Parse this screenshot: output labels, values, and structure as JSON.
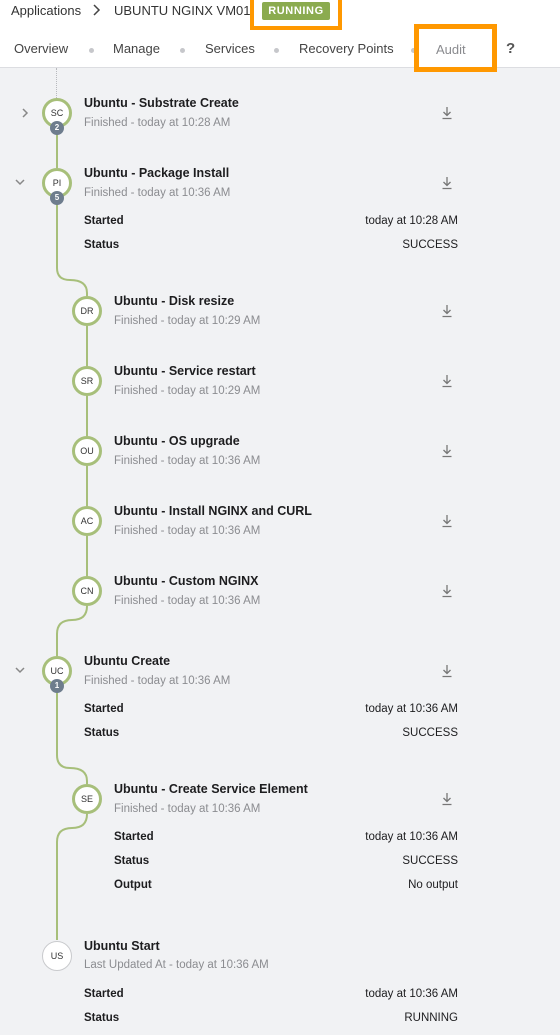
{
  "breadcrumb": {
    "root": "Applications",
    "app_name": "UBUNTU NGINX VM01",
    "status": "RUNNING"
  },
  "tabs": [
    "Overview",
    "Manage",
    "Services",
    "Recovery Points",
    "Audit"
  ],
  "help_label": "?",
  "colors": {
    "running": "#8bab4f",
    "node_ring": "#a7bf7a",
    "highlight": "#ff9800"
  },
  "audit": {
    "items": [
      {
        "abbr": "SC",
        "count": "2",
        "title": "Ubuntu - Substrate Create",
        "sub": "Finished - today at 10:28 AM",
        "icon": "chevron-right-icon"
      },
      {
        "abbr": "PI",
        "count": "5",
        "title": "Ubuntu - Package Install",
        "sub": "Finished - today at 10:36 AM",
        "icon": "chevron-down-icon",
        "details": [
          {
            "key": "Started",
            "value": "today at 10:28 AM"
          },
          {
            "key": "Status",
            "value": "SUCCESS"
          }
        ]
      },
      {
        "abbr": "DR",
        "title": "Ubuntu - Disk resize",
        "sub": "Finished - today at 10:29 AM"
      },
      {
        "abbr": "SR",
        "title": "Ubuntu - Service restart",
        "sub": "Finished - today at 10:29 AM"
      },
      {
        "abbr": "OU",
        "title": "Ubuntu - OS upgrade",
        "sub": "Finished - today at 10:36 AM"
      },
      {
        "abbr": "AC",
        "title": "Ubuntu - Install NGINX and CURL",
        "sub": "Finished - today at 10:36 AM"
      },
      {
        "abbr": "CN",
        "title": "Ubuntu - Custom NGINX",
        "sub": "Finished - today at 10:36 AM"
      },
      {
        "abbr": "UC",
        "count": "1",
        "title": "Ubuntu Create",
        "sub": "Finished - today at 10:36 AM",
        "icon": "chevron-down-icon",
        "details": [
          {
            "key": "Started",
            "value": "today at 10:36 AM"
          },
          {
            "key": "Status",
            "value": "SUCCESS"
          }
        ]
      },
      {
        "abbr": "SE",
        "title": "Ubuntu - Create Service Element",
        "sub": "Finished - today at 10:36 AM",
        "details": [
          {
            "key": "Started",
            "value": "today at 10:36 AM"
          },
          {
            "key": "Status",
            "value": "SUCCESS"
          },
          {
            "key": "Output",
            "value": "No output"
          }
        ]
      },
      {
        "abbr": "US",
        "title": "Ubuntu Start",
        "sub": "Last Updated At - today at 10:36 AM",
        "details": [
          {
            "key": "Started",
            "value": "today at 10:36 AM"
          },
          {
            "key": "Status",
            "value": "RUNNING"
          }
        ]
      }
    ]
  }
}
